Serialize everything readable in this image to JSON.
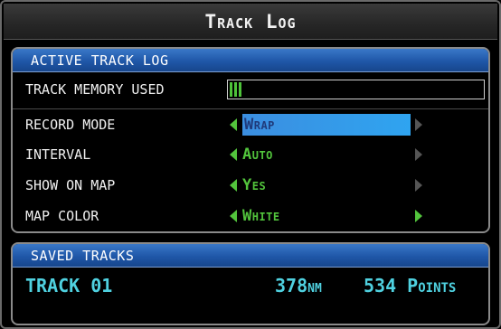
{
  "window": {
    "title": "Track Log"
  },
  "active_panel": {
    "header": "ACTIVE TRACK LOG",
    "memory": {
      "label": "TRACK MEMORY USED",
      "used_fraction": 0.05
    },
    "rows": [
      {
        "label": "RECORD MODE",
        "value": "Wrap",
        "selected": true,
        "right_arrow_active": false
      },
      {
        "label": "INTERVAL",
        "value": "Auto",
        "selected": false,
        "right_arrow_active": false
      },
      {
        "label": "SHOW ON MAP",
        "value": "Yes",
        "selected": false,
        "right_arrow_active": false
      },
      {
        "label": "MAP COLOR",
        "value": "White",
        "selected": false,
        "right_arrow_active": true
      }
    ]
  },
  "saved_panel": {
    "header": "SAVED TRACKS",
    "tracks": [
      {
        "name": "TRACK 01",
        "distance": "378",
        "distance_unit": "NM",
        "points": "534 Points"
      }
    ]
  },
  "colors": {
    "accent_green": "#52c43c",
    "cyan_text": "#4fd1e0",
    "header_blue": "#1f57a8",
    "selection_blue": "#2fa4f0"
  },
  "icons": {
    "left_arrow": "triangle-left-icon",
    "right_arrow": "triangle-right-icon"
  }
}
